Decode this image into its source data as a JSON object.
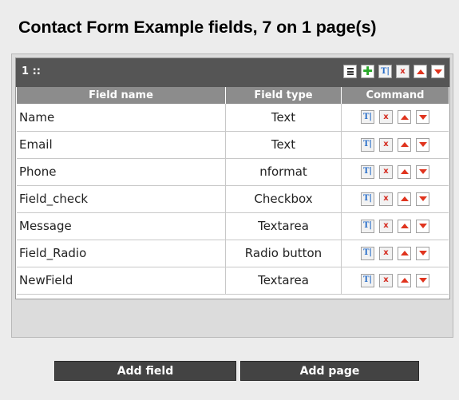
{
  "title": "Contact Form Example fields, 7 on 1 page(s)",
  "page": {
    "label": "1 ::",
    "header_buttons": [
      {
        "icon": "list-icon"
      },
      {
        "icon": "plus-icon"
      },
      {
        "icon": "edit-icon",
        "text": "T|"
      },
      {
        "icon": "delete-icon",
        "text": "x"
      },
      {
        "icon": "move-up-icon"
      },
      {
        "icon": "move-down-icon"
      }
    ]
  },
  "table": {
    "headers": [
      "Field name",
      "Field type",
      "Command"
    ],
    "rows": [
      {
        "name": "Name",
        "type": "Text"
      },
      {
        "name": "Email",
        "type": "Text"
      },
      {
        "name": "Phone",
        "type": "nformat"
      },
      {
        "name": "Field_check",
        "type": "Checkbox"
      },
      {
        "name": "Message",
        "type": "Textarea"
      },
      {
        "name": "Field_Radio",
        "type": "Radio button"
      },
      {
        "name": "NewField",
        "type": "Textarea"
      }
    ],
    "command_icons": {
      "edit": "T|",
      "delete": "x"
    }
  },
  "buttons": {
    "add_field": "Add field",
    "add_page": "Add page"
  }
}
